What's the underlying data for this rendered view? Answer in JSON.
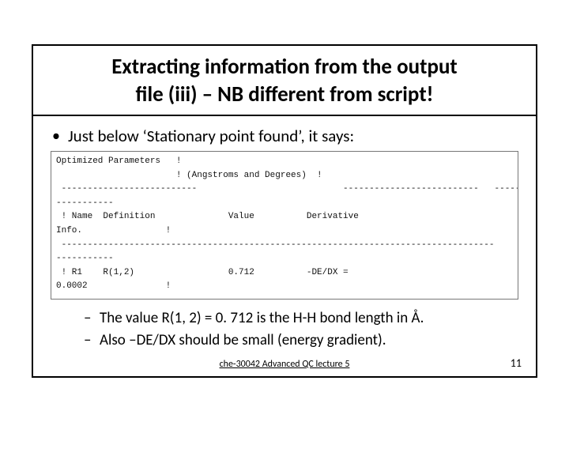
{
  "title_line1": "Extracting information from the output",
  "title_line2": "file (iii) – NB different from script!",
  "bullet1": "Just below ‘Stationary point found’, it says:",
  "mono": {
    "l1": "Optimized Parameters   !",
    "l2": "                       ! (Angstroms and Degrees)  !",
    "l3": " --------------------------                            --------------------------   ---------",
    "l4": "-----------",
    "l5": " ! Name  Definition              Value          Derivative",
    "l6": "Info.                !",
    "l7": " -----------------------------------------------------------------------------------",
    "l8": "-----------",
    "l9": " ! R1    R(1,2)                  0.712          -DE/DX =",
    "l10": "0.0002               !"
  },
  "sub1": "The value R(1, 2) = 0. 712 is the H-H bond length in Å.",
  "sub2": "Also –DE/DX should be small (energy gradient).",
  "footer": "che-30042 Advanced QC lecture 5",
  "page": "11"
}
